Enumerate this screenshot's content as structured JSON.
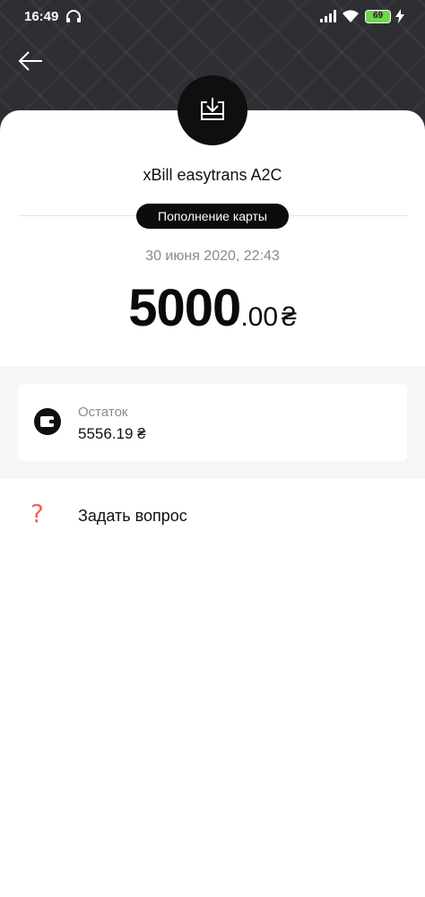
{
  "status_bar": {
    "time": "16:49",
    "battery": "69",
    "icons": [
      "headphones-icon",
      "signal-icon",
      "wifi-icon",
      "battery-icon",
      "charging-bolt-icon"
    ]
  },
  "header": {
    "back_icon": "arrow-left-icon",
    "transaction_icon": "download-tray-icon"
  },
  "transaction": {
    "merchant": "xBill easytrans A2C",
    "category": "Пополнение карты",
    "date": "30 июня 2020, 22:43",
    "amount_integer": "5000",
    "amount_fraction": ".00",
    "currency": "₴"
  },
  "balance": {
    "label": "Остаток",
    "value": "5556.19 ₴",
    "icon": "wallet-icon"
  },
  "help": {
    "label": "Задать вопрос",
    "icon": "question-mark-icon",
    "icon_color": "#ff5a5a"
  },
  "colors": {
    "header_bg": "#2e2f33",
    "badge_bg": "#0c0c0c",
    "battery": "#6fd64b",
    "secondary_text": "#8a8a8a"
  }
}
